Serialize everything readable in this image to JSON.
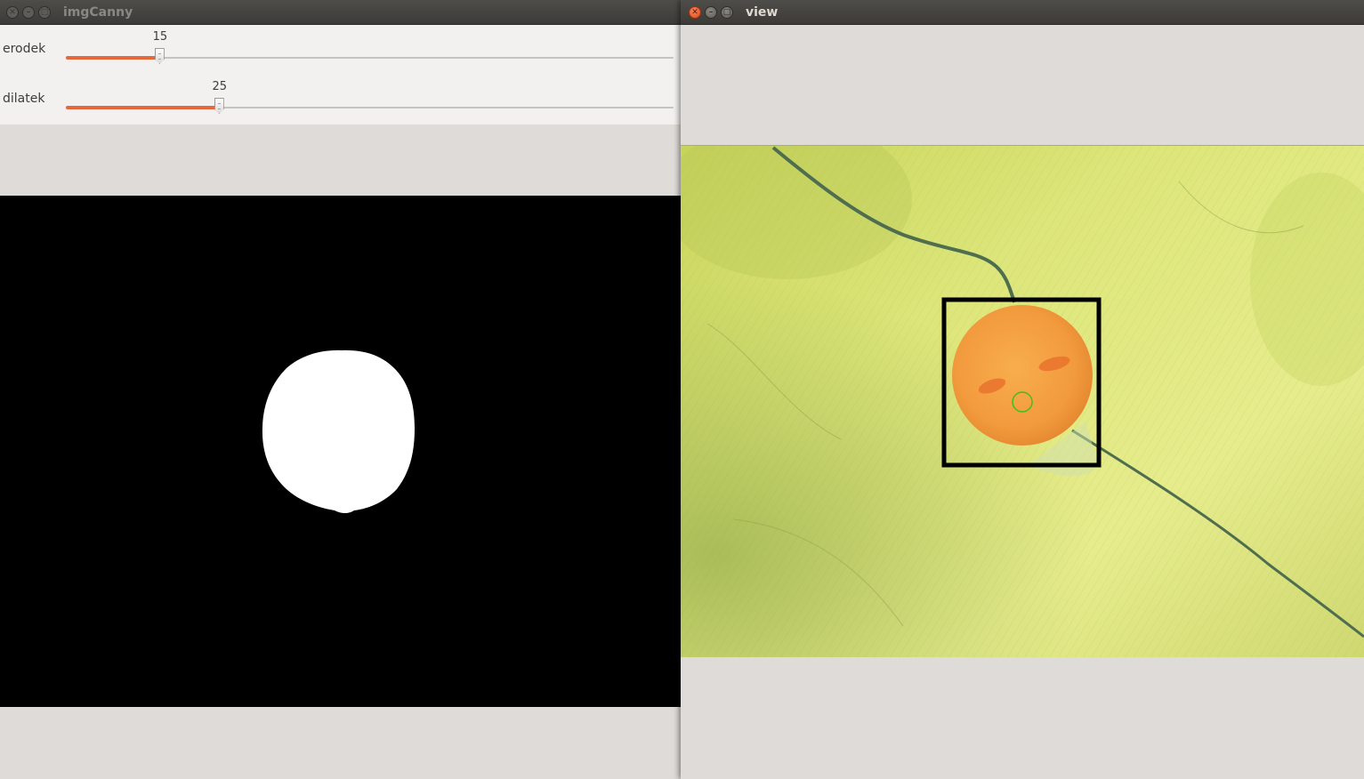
{
  "windows": {
    "canny": {
      "title": "imgCanny",
      "trackbars": [
        {
          "label": "erodek",
          "value": "15",
          "fraction": 0.155
        },
        {
          "label": "dilatek",
          "value": "25",
          "fraction": 0.253
        }
      ]
    },
    "view": {
      "title": "view"
    }
  },
  "colors": {
    "slider_fill": "#e4683c",
    "close_button": "#df4a17",
    "mask_foreground": "#ffffff",
    "mask_background": "#000000",
    "bounding_box": "#000000",
    "center_marker": "#3fbf1f",
    "object_orange": "#f29a3e",
    "surface_green": "#d4df6a"
  },
  "icons": {
    "close": "close-icon",
    "minimize": "minimize-icon",
    "maximize": "maximize-icon"
  }
}
